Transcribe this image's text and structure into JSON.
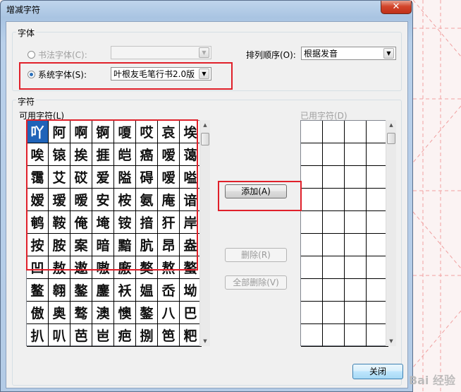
{
  "dialog": {
    "title": "增减字符",
    "close_glyph": "✕"
  },
  "font_group": {
    "label": "字体",
    "calligraphy_radio": "书法字体(C):",
    "calligraphy_combo": "",
    "system_radio": "系统字体(S):",
    "system_combo": "叶根友毛笔行书2.0版",
    "sort_label": "排列顺序(O):",
    "sort_combo": "根据发音"
  },
  "char_group": {
    "label": "字符",
    "available_label": "可用字符(L)",
    "selected_label": "已用字符(D)",
    "available_chars": [
      [
        "吖",
        "阿",
        "啊",
        "锕",
        "嗄",
        "哎",
        "哀",
        "埃"
      ],
      [
        "唉",
        "锿",
        "挨",
        "捱",
        "皑",
        "癌",
        "嗳",
        "蔼"
      ],
      [
        "霭",
        "艾",
        "砹",
        "爱",
        "隘",
        "碍",
        "嗳",
        "嗌"
      ],
      [
        "嫒",
        "瑷",
        "暧",
        "安",
        "桉",
        "氨",
        "庵",
        "谙"
      ],
      [
        "鹌",
        "鞍",
        "俺",
        "埯",
        "铵",
        "揞",
        "犴",
        "岸"
      ],
      [
        "按",
        "胺",
        "案",
        "暗",
        "黯",
        "肮",
        "昂",
        "盎"
      ],
      [
        "凹",
        "敖",
        "遨",
        "嗷",
        "廒",
        "獒",
        "熬",
        "螯"
      ],
      [
        "鳌",
        "翱",
        "鏊",
        "鏖",
        "袄",
        "媪",
        "岙",
        "坳"
      ],
      [
        "傲",
        "奥",
        "骜",
        "澳",
        "懊",
        "鏊",
        "八",
        "巴"
      ],
      [
        "扒",
        "叭",
        "芭",
        "岜",
        "疤",
        "捌",
        "笆",
        "粑"
      ]
    ]
  },
  "buttons": {
    "add": "添加(A)",
    "delete": "删除(R)",
    "delete_all": "全部删除(V)",
    "close": "关闭"
  },
  "watermark": "Bai 经验"
}
